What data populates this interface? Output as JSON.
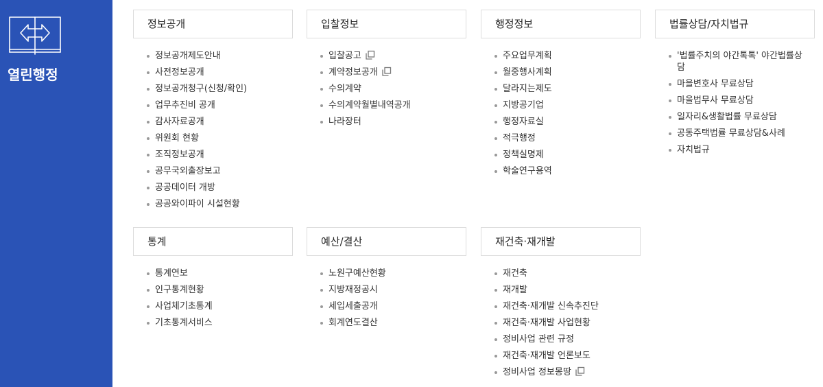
{
  "sidebar": {
    "title": "열린행정",
    "logo_icon": "open-book-arrows-icon",
    "bg": "#2a53b6"
  },
  "categories": [
    {
      "title": "정보공개",
      "items": [
        {
          "label": "정보공개제도안내",
          "external": false
        },
        {
          "label": "사전정보공개",
          "external": false
        },
        {
          "label": "정보공개청구(신청/확인)",
          "external": false
        },
        {
          "label": "업무추진비 공개",
          "external": false
        },
        {
          "label": "감사자료공개",
          "external": false
        },
        {
          "label": "위원회 현황",
          "external": false
        },
        {
          "label": "조직정보공개",
          "external": false
        },
        {
          "label": "공무국외출장보고",
          "external": false
        },
        {
          "label": "공공데이터 개방",
          "external": false
        },
        {
          "label": "공공와이파이 시설현황",
          "external": false
        }
      ]
    },
    {
      "title": "입찰정보",
      "items": [
        {
          "label": "입찰공고",
          "external": true
        },
        {
          "label": "계약정보공개",
          "external": true
        },
        {
          "label": "수의계약",
          "external": false
        },
        {
          "label": "수의계약월별내역공개",
          "external": false
        },
        {
          "label": "나라장터",
          "external": false
        }
      ]
    },
    {
      "title": "행정정보",
      "items": [
        {
          "label": "주요업무계획",
          "external": false
        },
        {
          "label": "월중행사계획",
          "external": false
        },
        {
          "label": "달라지는제도",
          "external": false
        },
        {
          "label": "지방공기업",
          "external": false
        },
        {
          "label": "행정자료실",
          "external": false
        },
        {
          "label": "적극행정",
          "external": false
        },
        {
          "label": "정책실명제",
          "external": false
        },
        {
          "label": "학술연구용역",
          "external": false
        }
      ]
    },
    {
      "title": "법률상담/자치법규",
      "items": [
        {
          "label": "'법률주치의 야간톡톡' 야간법률상담",
          "external": false
        },
        {
          "label": "마을변호사 무료상담",
          "external": false
        },
        {
          "label": "마을법무사 무료상담",
          "external": false
        },
        {
          "label": "일자리&생활법률 무료상담",
          "external": false
        },
        {
          "label": "공동주택법률 무료상담&사례",
          "external": false
        },
        {
          "label": "자치법규",
          "external": false
        }
      ]
    },
    {
      "title": "통계",
      "items": [
        {
          "label": "통계연보",
          "external": false
        },
        {
          "label": "인구통계현황",
          "external": false
        },
        {
          "label": "사업체기초통계",
          "external": false
        },
        {
          "label": "기초통계서비스",
          "external": false
        }
      ]
    },
    {
      "title": "예산/결산",
      "items": [
        {
          "label": "노원구예산현황",
          "external": false
        },
        {
          "label": "지방재정공시",
          "external": false
        },
        {
          "label": "세입세출공개",
          "external": false
        },
        {
          "label": "회계연도결산",
          "external": false
        }
      ]
    },
    {
      "title": "재건축·재개발",
      "items": [
        {
          "label": "재건축",
          "external": false
        },
        {
          "label": "재개발",
          "external": false
        },
        {
          "label": "재건축·재개발 신속추진단",
          "external": false
        },
        {
          "label": "재건축·재개발 사업현황",
          "external": false
        },
        {
          "label": "정비사업 관련 규정",
          "external": false
        },
        {
          "label": "재건축·재개발 언론보도",
          "external": false
        },
        {
          "label": "정비사업 정보몽땅",
          "external": true
        }
      ]
    }
  ]
}
